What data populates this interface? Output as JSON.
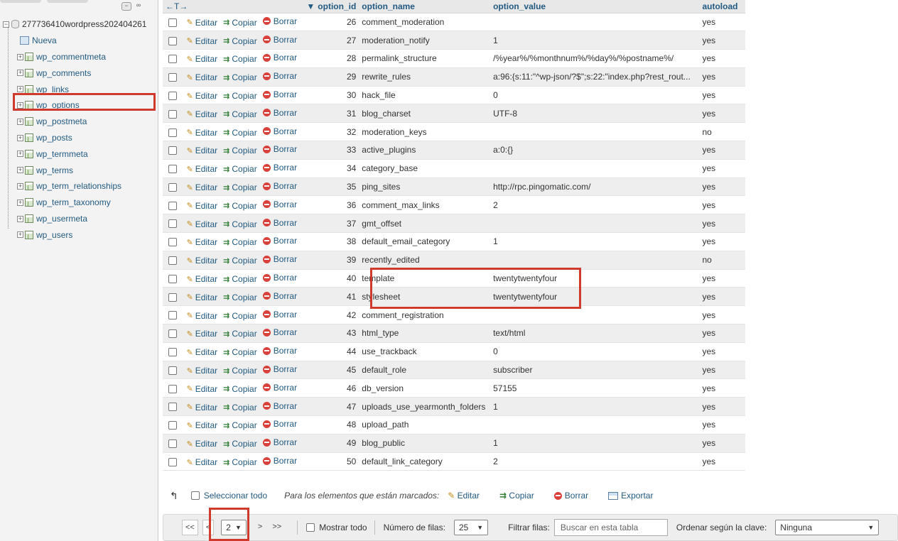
{
  "sidebar": {
    "database": "277736410wordpress202404261",
    "new_label": "Nueva",
    "tables": [
      "wp_commentmeta",
      "wp_comments",
      "wp_links",
      "wp_options",
      "wp_postmeta",
      "wp_posts",
      "wp_termmeta",
      "wp_terms",
      "wp_term_relationships",
      "wp_term_taxonomy",
      "wp_usermeta",
      "wp_users"
    ],
    "selected_table": "wp_options"
  },
  "table": {
    "nav_arrows": "←T→",
    "sort_indicator": "▼",
    "columns": [
      "option_id",
      "option_name",
      "option_value",
      "autoload"
    ],
    "action_labels": {
      "edit": "Editar",
      "copy": "Copiar",
      "delete": "Borrar"
    },
    "rows": [
      {
        "id": "26",
        "name": "comment_moderation",
        "value": "",
        "autoload": "yes"
      },
      {
        "id": "27",
        "name": "moderation_notify",
        "value": "1",
        "autoload": "yes"
      },
      {
        "id": "28",
        "name": "permalink_structure",
        "value": "/%year%/%monthnum%/%day%/%postname%/",
        "autoload": "yes"
      },
      {
        "id": "29",
        "name": "rewrite_rules",
        "value": "a:96:{s:11:\"^wp-json/?$\";s:22:\"index.php?rest_rout...",
        "autoload": "yes"
      },
      {
        "id": "30",
        "name": "hack_file",
        "value": "0",
        "autoload": "yes"
      },
      {
        "id": "31",
        "name": "blog_charset",
        "value": "UTF-8",
        "autoload": "yes"
      },
      {
        "id": "32",
        "name": "moderation_keys",
        "value": "",
        "autoload": "no"
      },
      {
        "id": "33",
        "name": "active_plugins",
        "value": "a:0:{}",
        "autoload": "yes"
      },
      {
        "id": "34",
        "name": "category_base",
        "value": "",
        "autoload": "yes"
      },
      {
        "id": "35",
        "name": "ping_sites",
        "value": "http://rpc.pingomatic.com/",
        "autoload": "yes"
      },
      {
        "id": "36",
        "name": "comment_max_links",
        "value": "2",
        "autoload": "yes"
      },
      {
        "id": "37",
        "name": "gmt_offset",
        "value": "",
        "autoload": "yes"
      },
      {
        "id": "38",
        "name": "default_email_category",
        "value": "1",
        "autoload": "yes"
      },
      {
        "id": "39",
        "name": "recently_edited",
        "value": "",
        "autoload": "no"
      },
      {
        "id": "40",
        "name": "template",
        "value": "twentytwentyfour",
        "autoload": "yes"
      },
      {
        "id": "41",
        "name": "stylesheet",
        "value": "twentytwentyfour",
        "autoload": "yes"
      },
      {
        "id": "42",
        "name": "comment_registration",
        "value": "",
        "autoload": "yes"
      },
      {
        "id": "43",
        "name": "html_type",
        "value": "text/html",
        "autoload": "yes"
      },
      {
        "id": "44",
        "name": "use_trackback",
        "value": "0",
        "autoload": "yes"
      },
      {
        "id": "45",
        "name": "default_role",
        "value": "subscriber",
        "autoload": "yes"
      },
      {
        "id": "46",
        "name": "db_version",
        "value": "57155",
        "autoload": "yes"
      },
      {
        "id": "47",
        "name": "uploads_use_yearmonth_folders",
        "value": "1",
        "autoload": "yes"
      },
      {
        "id": "48",
        "name": "upload_path",
        "value": "",
        "autoload": "yes"
      },
      {
        "id": "49",
        "name": "blog_public",
        "value": "1",
        "autoload": "yes"
      },
      {
        "id": "50",
        "name": "default_link_category",
        "value": "2",
        "autoload": "yes"
      }
    ]
  },
  "bulk": {
    "select_all": "Seleccionar todo",
    "marked_label": "Para los elementos que están marcados:",
    "edit": "Editar",
    "copy": "Copiar",
    "delete": "Borrar",
    "export": "Exportar"
  },
  "navigation": {
    "first": "<<",
    "prev": "<",
    "page": "2",
    "next": ">",
    "last": ">>",
    "show_all": "Mostrar todo",
    "rows_label": "Número de filas:",
    "rows_value": "25",
    "filter_label": "Filtrar filas:",
    "filter_placeholder": "Buscar en esta tabla",
    "sort_label": "Ordenar según la clave:",
    "sort_value": "Ninguna"
  },
  "colors": {
    "highlight": "#d03a2c",
    "link": "#235a81"
  }
}
